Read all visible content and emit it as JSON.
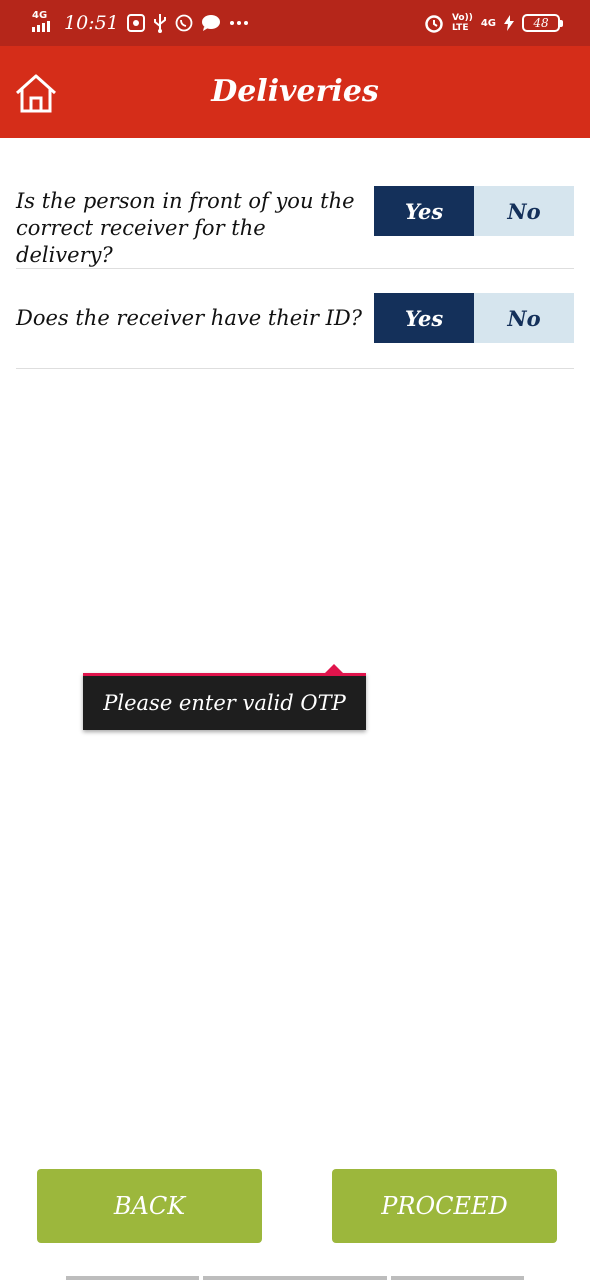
{
  "status_bar": {
    "network_left": "4G",
    "time": "10:51",
    "volte_line1": "Vo))",
    "volte_line2": "LTE",
    "network_right": "4G",
    "battery": "48",
    "icons": [
      "app-notification-icon",
      "usb-icon",
      "whatsapp-icon",
      "message-icon",
      "more-dots-icon",
      "alarm-icon",
      "charging-bolt-icon",
      "battery-icon"
    ]
  },
  "header": {
    "title": "Deliveries",
    "home_icon": "home-icon"
  },
  "questions": [
    {
      "text": "Is the person in front of you the correct receiver for the delivery?",
      "yes": "Yes",
      "no": "No",
      "selected": "Yes"
    },
    {
      "text": "Does the receiver have their ID?",
      "yes": "Yes",
      "no": "No",
      "selected": "Yes"
    }
  ],
  "toast": {
    "message": "Please enter valid OTP"
  },
  "buttons": {
    "back": "BACK",
    "proceed": "PROCEED"
  },
  "colors": {
    "status_bar": "#b5261a",
    "app_bar": "#d52d19",
    "selected_option": "#14305a",
    "unselected_option": "#d6e5ee",
    "button": "#9cb73c",
    "toast_accent": "#e0144c"
  }
}
